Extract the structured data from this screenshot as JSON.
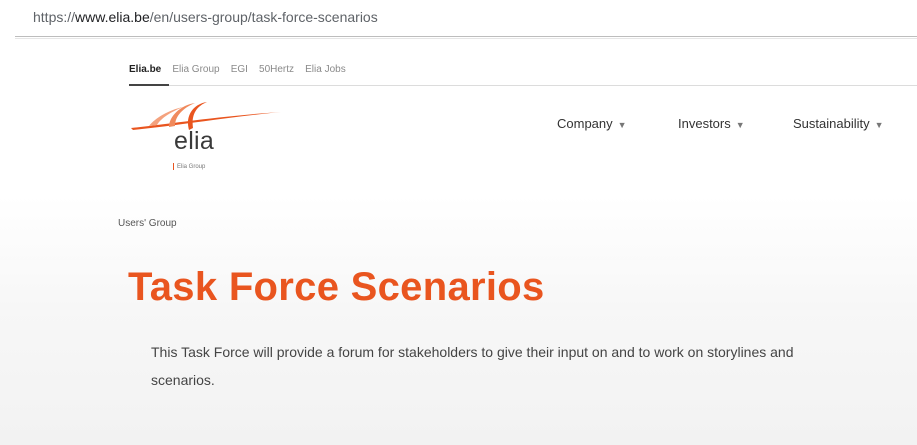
{
  "browser": {
    "url_prefix": "https://",
    "url_domain": "www.elia.be",
    "url_path": "/en/users-group/task-force-scenarios"
  },
  "site_links": [
    {
      "label": "Elia.be",
      "active": true
    },
    {
      "label": "Elia Group"
    },
    {
      "label": "EGI"
    },
    {
      "label": "50Hertz"
    },
    {
      "label": "Elia Jobs"
    }
  ],
  "logo": {
    "word": "elia",
    "sub": "Elia Group",
    "color": "#e9551f"
  },
  "nav": [
    {
      "label": "Company"
    },
    {
      "label": "Investors"
    },
    {
      "label": "Sustainability"
    }
  ],
  "caret_icon": "chevron-down-icon",
  "breadcrumb": "Users' Group",
  "page": {
    "title": "Task Force Scenarios",
    "description": "This Task Force will provide a forum for stakeholders to give their input on and to work on storylines and scenarios.",
    "title_color": "#e9551f"
  }
}
